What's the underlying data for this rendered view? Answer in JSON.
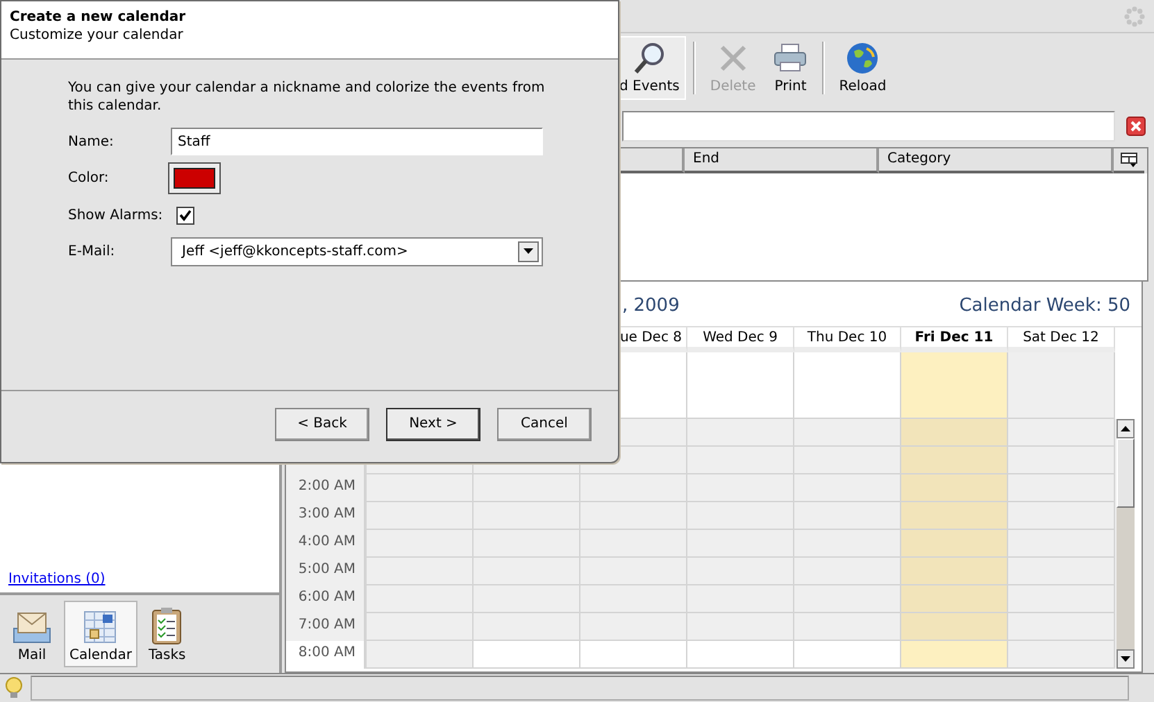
{
  "toolbar": [
    {
      "label": "d Events",
      "kind": "find",
      "selected": true,
      "disabled": false
    },
    {
      "label": "Delete",
      "kind": "delete",
      "selected": false,
      "disabled": true
    },
    {
      "label": "Print",
      "kind": "print",
      "selected": false,
      "disabled": false
    },
    {
      "label": "Reload",
      "kind": "reload",
      "selected": false,
      "disabled": false
    }
  ],
  "events_table": {
    "columns": [
      "End",
      "Category"
    ]
  },
  "calendar": {
    "title": ", 2009",
    "week": "Calendar Week: 50",
    "days": [
      {
        "label": "ue Dec 8",
        "today": false,
        "weekend": false
      },
      {
        "label": "Wed Dec 9",
        "today": false,
        "weekend": false
      },
      {
        "label": "Thu Dec 10",
        "today": false,
        "weekend": false
      },
      {
        "label": "Fri Dec 11",
        "today": true,
        "weekend": false
      },
      {
        "label": "Sat Dec 12",
        "today": false,
        "weekend": true
      }
    ],
    "hours": [
      {
        "label": "2:00 AM",
        "working": false
      },
      {
        "label": "3:00 AM",
        "working": false
      },
      {
        "label": "4:00 AM",
        "working": false
      },
      {
        "label": "5:00 AM",
        "working": false
      },
      {
        "label": "6:00 AM",
        "working": false
      },
      {
        "label": "7:00 AM",
        "working": false
      },
      {
        "label": "8:00 AM",
        "working": true
      }
    ]
  },
  "sidebar": {
    "link": "Invitations (0)",
    "nav": [
      {
        "label": "Mail",
        "kind": "mail",
        "selected": false
      },
      {
        "label": "Calendar",
        "kind": "calendar",
        "selected": true
      },
      {
        "label": "Tasks",
        "kind": "tasks",
        "selected": false
      }
    ]
  },
  "dialog": {
    "title": "Create a new calendar",
    "subtitle": "Customize your calendar",
    "intro": "You can give your calendar a nickname and colorize the events from this calendar.",
    "fields": [
      {
        "kind": "text",
        "label": "Name:",
        "value": "Staff"
      },
      {
        "kind": "color",
        "label": "Color:",
        "color": "#cc0000"
      },
      {
        "kind": "checkbox",
        "label": "Show Alarms:",
        "checked": true
      },
      {
        "kind": "select",
        "label": "E-Mail:",
        "value": "Jeff <jeff@kkoncepts-staff.com>"
      }
    ],
    "buttons": [
      {
        "label": "< Back",
        "default": false
      },
      {
        "label": "Next >",
        "default": true
      },
      {
        "label": "Cancel",
        "default": false
      }
    ]
  }
}
